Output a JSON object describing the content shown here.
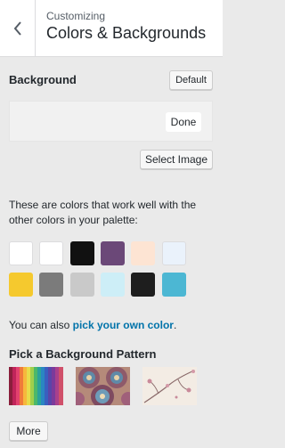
{
  "header": {
    "crumb": "Customizing",
    "title": "Colors & Backgrounds",
    "back_icon": "chevron-left-icon"
  },
  "background": {
    "title": "Background",
    "default_label": "Default",
    "done_label": "Done",
    "select_image_label": "Select Image"
  },
  "palette": {
    "description": "These are colors that work well with the other colors in your palette:",
    "swatches": [
      {
        "color": "#ffffff"
      },
      {
        "color": "#ffffff"
      },
      {
        "color": "#111111"
      },
      {
        "color": "#6b4878"
      },
      {
        "color": "#fde4d3"
      },
      {
        "color": "#eaf2fb"
      },
      {
        "color": "#f5c92e"
      },
      {
        "color": "#7b7b7b"
      },
      {
        "color": "#c9c9c9"
      },
      {
        "color": "#cdeef7"
      },
      {
        "color": "#1e1e1e"
      },
      {
        "color": "#4cb7d3"
      }
    ],
    "own_color_prefix": "You can also ",
    "own_color_link": "pick your own color",
    "own_color_suffix": "."
  },
  "patterns": {
    "title": "Pick a Background Pattern",
    "items": [
      {
        "name": "rainbow-stripes-pattern"
      },
      {
        "name": "mandala-pattern"
      },
      {
        "name": "floral-branch-pattern"
      }
    ],
    "more_label": "More"
  }
}
